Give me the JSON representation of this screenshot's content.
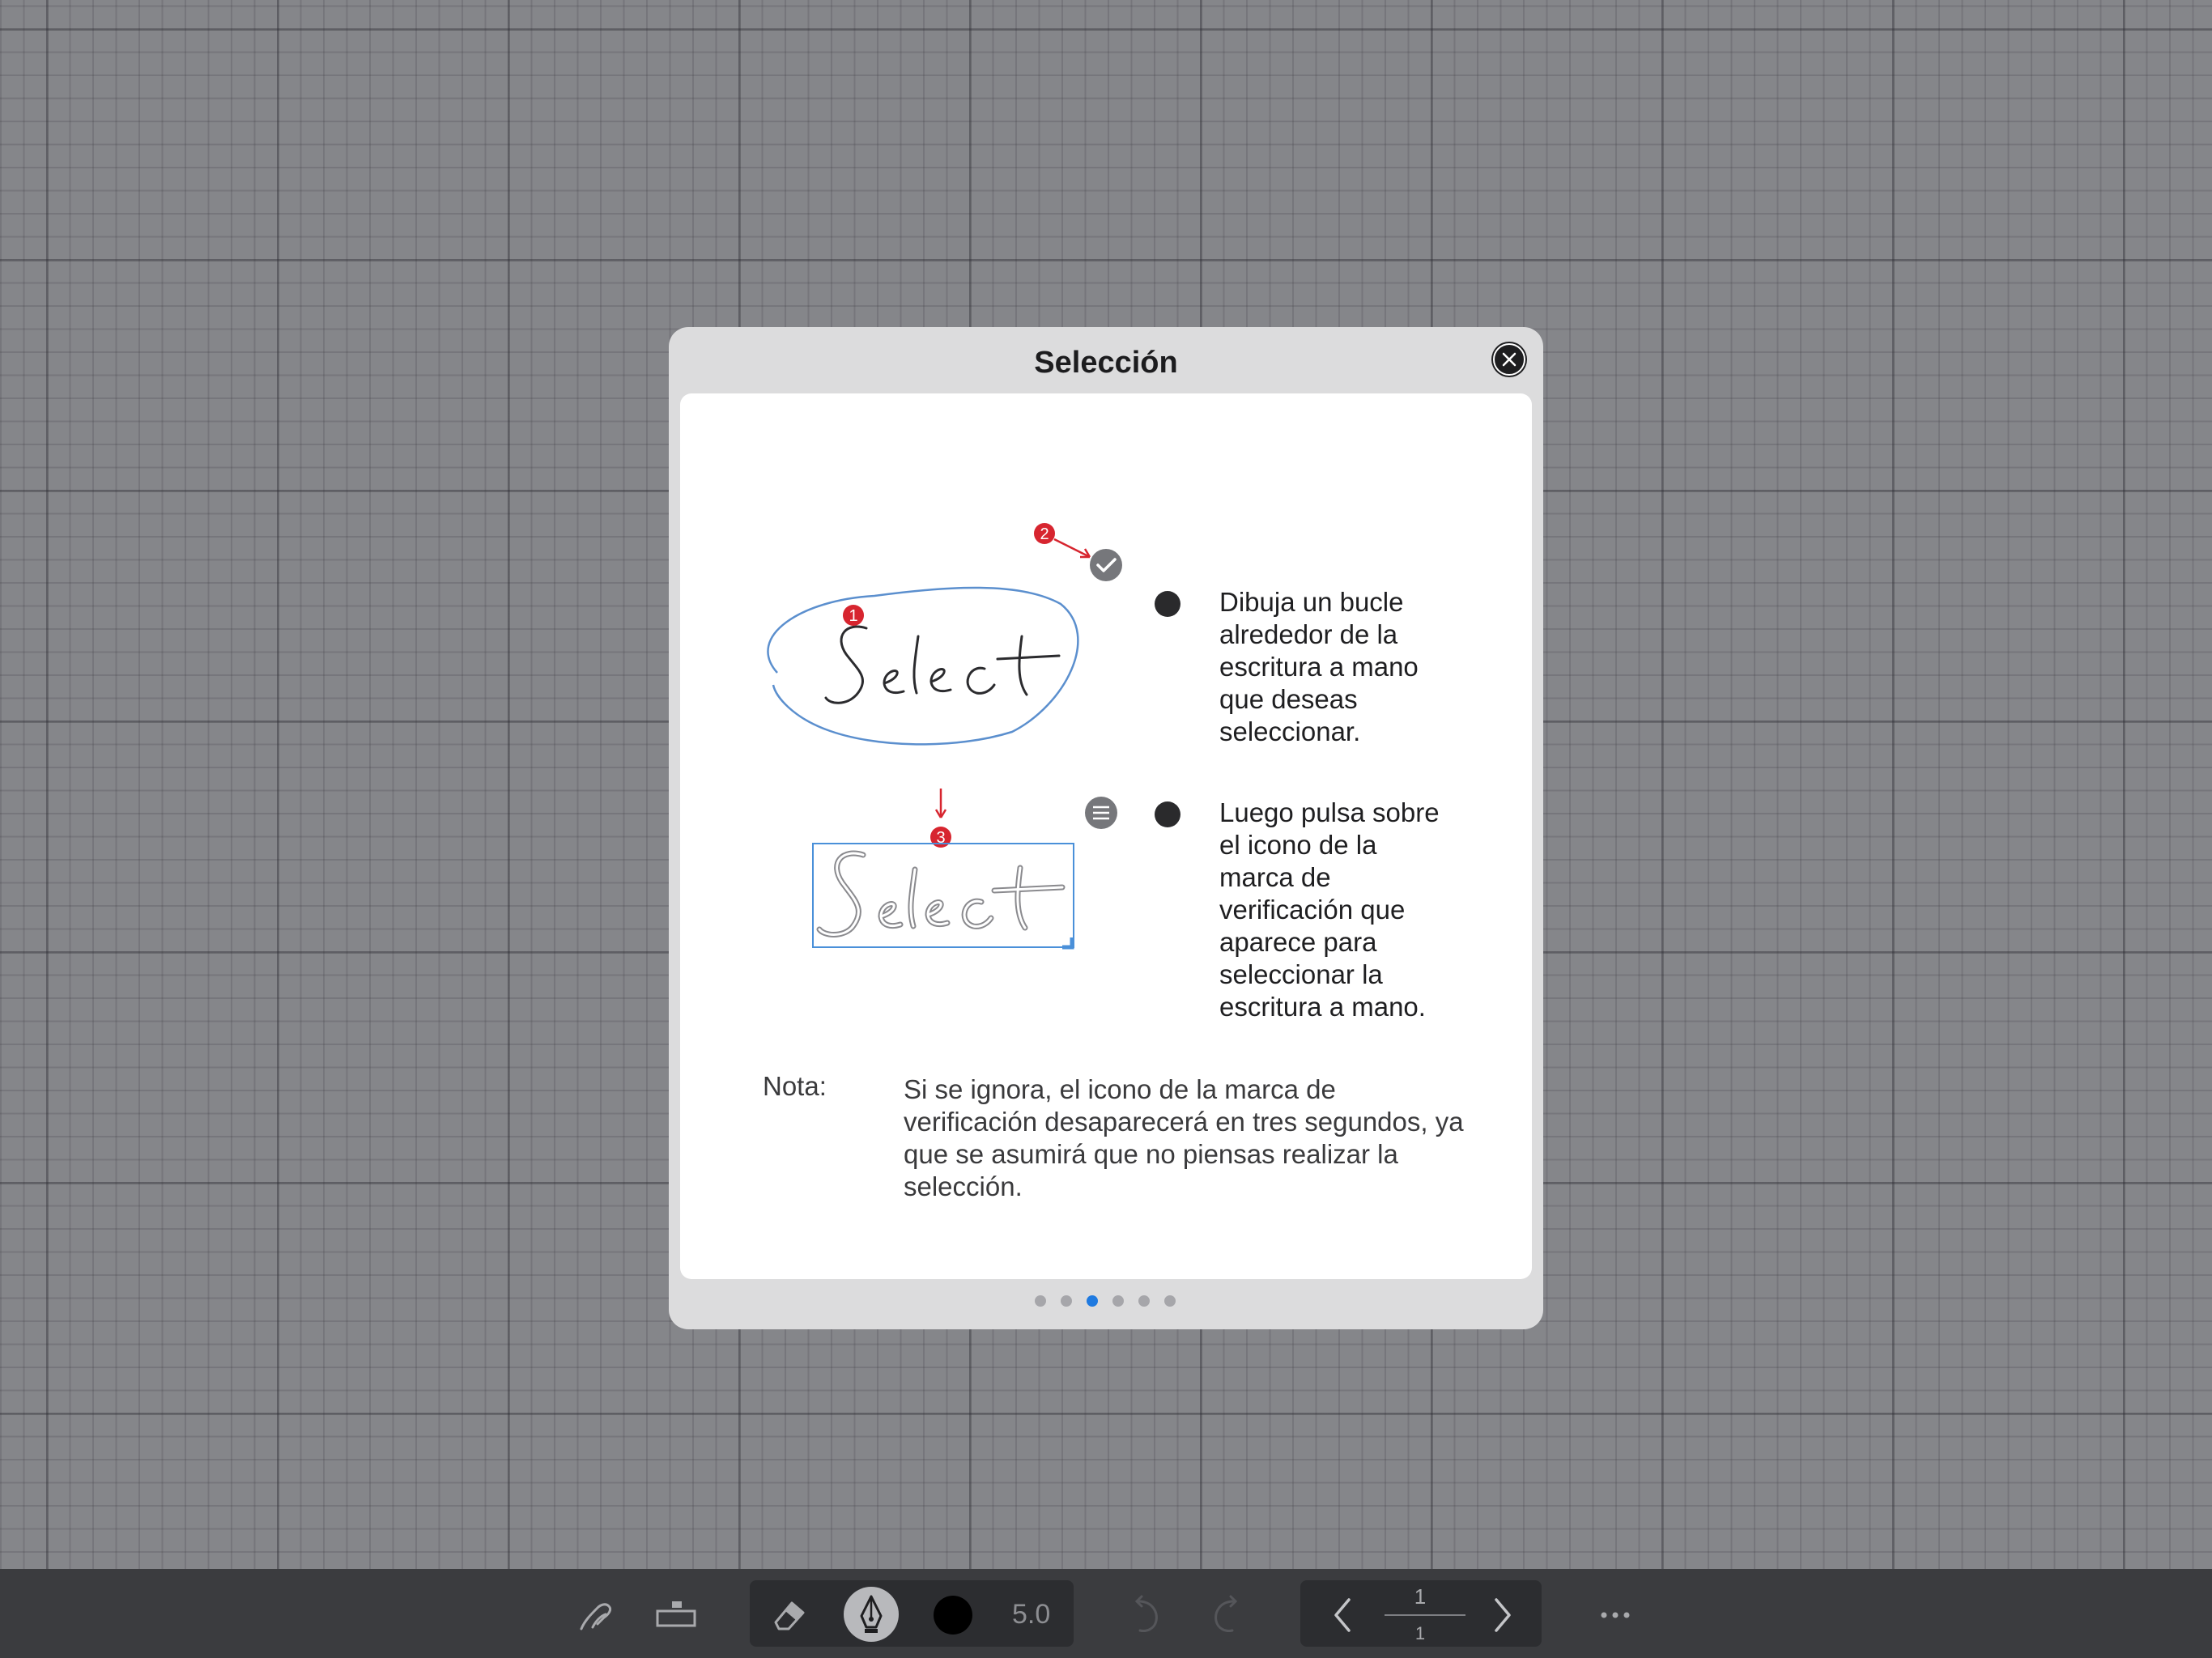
{
  "dialog": {
    "title": "Selección",
    "illustration": {
      "sample_word": "Select",
      "markers": [
        "1",
        "2",
        "3"
      ],
      "icons": [
        "checkmark-icon",
        "menu-icon"
      ]
    },
    "steps": [
      {
        "lines": [
          "Dibuja un bucle",
          "alrededor de la",
          "escritura a mano",
          "que deseas",
          "seleccionar."
        ]
      },
      {
        "lines": [
          "Luego pulsa sobre",
          "el icono de la",
          "marca de",
          "verificación que",
          "aparece para",
          "seleccionar la",
          "escritura a mano."
        ]
      }
    ],
    "note_label": "Nota:",
    "note_lines": [
      "Si se ignora, el icono de la marca de",
      "verificación desaparecerá en tres segundos, ya",
      "que se asumirá que no piensas realizar la",
      "selección."
    ],
    "pages_total": 6,
    "current_page_index": 2
  },
  "toolbar": {
    "pen_size": "5.0",
    "current_color": "#000000",
    "page_current": "1",
    "page_total": "1",
    "icons": [
      "lasso-hand-icon",
      "ruler-icon",
      "eraser-icon",
      "fountain-pen-icon",
      "undo-icon",
      "redo-icon",
      "chevron-left-icon",
      "chevron-right-icon",
      "more-icon"
    ]
  },
  "colors": {
    "accent": "#1f7ae0",
    "marker_red": "#d7252f",
    "selection_blue": "#4a90d9"
  }
}
